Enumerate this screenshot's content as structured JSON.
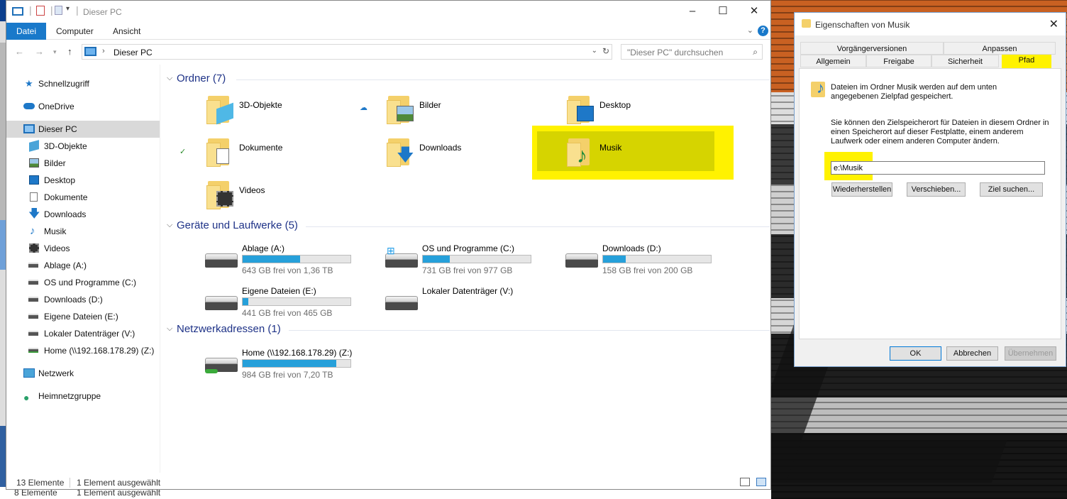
{
  "explorer": {
    "title": "Dieser PC",
    "ribbon_tabs": [
      "Datei",
      "Computer",
      "Ansicht"
    ],
    "address": "Dieser PC",
    "search_placeholder": "\"Dieser PC\" durchsuchen",
    "sidebar": [
      {
        "label": "Schnellzugriff",
        "icon": "star-icon"
      },
      {
        "label": "OneDrive",
        "icon": "cloud-icon"
      },
      {
        "label": "Dieser PC",
        "icon": "computer-icon"
      },
      {
        "label": "3D-Objekte",
        "icon": "cube-icon"
      },
      {
        "label": "Bilder",
        "icon": "pictures-icon"
      },
      {
        "label": "Desktop",
        "icon": "desktop-icon"
      },
      {
        "label": "Dokumente",
        "icon": "document-icon"
      },
      {
        "label": "Downloads",
        "icon": "download-icon"
      },
      {
        "label": "Musik",
        "icon": "music-icon"
      },
      {
        "label": "Videos",
        "icon": "video-icon"
      },
      {
        "label": "Ablage (A:)",
        "icon": "drive-icon"
      },
      {
        "label": "OS und Programme (C:)",
        "icon": "windows-drive-icon"
      },
      {
        "label": "Downloads (D:)",
        "icon": "drive-icon"
      },
      {
        "label": "Eigene Dateien (E:)",
        "icon": "drive-icon"
      },
      {
        "label": "Lokaler Datenträger (V:)",
        "icon": "drive-icon"
      },
      {
        "label": "Home (\\\\192.168.178.29) (Z:)",
        "icon": "network-drive-icon"
      },
      {
        "label": "Netzwerk",
        "icon": "network-icon"
      },
      {
        "label": "Heimnetzgruppe",
        "icon": "homegroup-icon"
      }
    ],
    "groups": {
      "folders": "Ordner (7)",
      "drives": "Geräte und Laufwerke (5)",
      "network": "Netzwerkadressen (1)"
    },
    "folders": [
      "3D-Objekte",
      "Bilder",
      "Desktop",
      "Dokumente",
      "Downloads",
      "Musik",
      "Videos"
    ],
    "drives": [
      {
        "name": "Ablage (A:)",
        "free": "643 GB frei von 1,36 TB",
        "used_fraction": 0.53
      },
      {
        "name": "OS und Programme (C:)",
        "free": "731 GB frei von 977 GB",
        "used_fraction": 0.25
      },
      {
        "name": "Downloads (D:)",
        "free": "158 GB frei von 200 GB",
        "used_fraction": 0.21
      },
      {
        "name": "Eigene Dateien (E:)",
        "free": "441 GB frei von 465 GB",
        "used_fraction": 0.05
      },
      {
        "name": "Lokaler Datenträger (V:)",
        "free": "",
        "used_fraction": null
      }
    ],
    "network_drives": [
      {
        "name": "Home (\\\\192.168.178.29) (Z:)",
        "free": "984 GB frei von 7,20 TB",
        "used_fraction": 0.87
      }
    ],
    "status": {
      "count": "13 Elemente",
      "selection": "1 Element ausgewählt"
    }
  },
  "background_status": {
    "count": "8 Elemente",
    "selection": "1 Element ausgewählt"
  },
  "dialog": {
    "title": "Eigenschaften von Musik",
    "tabs_row1": [
      "Vorgängerversionen",
      "Anpassen"
    ],
    "tabs_row2": [
      "Allgemein",
      "Freigabe",
      "Sicherheit",
      "Pfad"
    ],
    "desc1": "Dateien im Ordner Musik werden auf dem unten angegebenen Zielpfad gespeichert.",
    "desc2": "Sie können den Zielspeicherort für Dateien in diesem Ordner in einen Speicherort auf dieser Festplatte, einem anderem Laufwerk oder einem anderen Computer ändern.",
    "path_value": "e:\\Musik",
    "buttons": [
      "Wiederherstellen",
      "Verschieben...",
      "Ziel suchen..."
    ],
    "footer": [
      "OK",
      "Abbrechen",
      "Übernehmen"
    ]
  },
  "colors": {
    "accent": "#1979ca",
    "highlight": "#fff200",
    "drive_bar": "#26a0da"
  }
}
